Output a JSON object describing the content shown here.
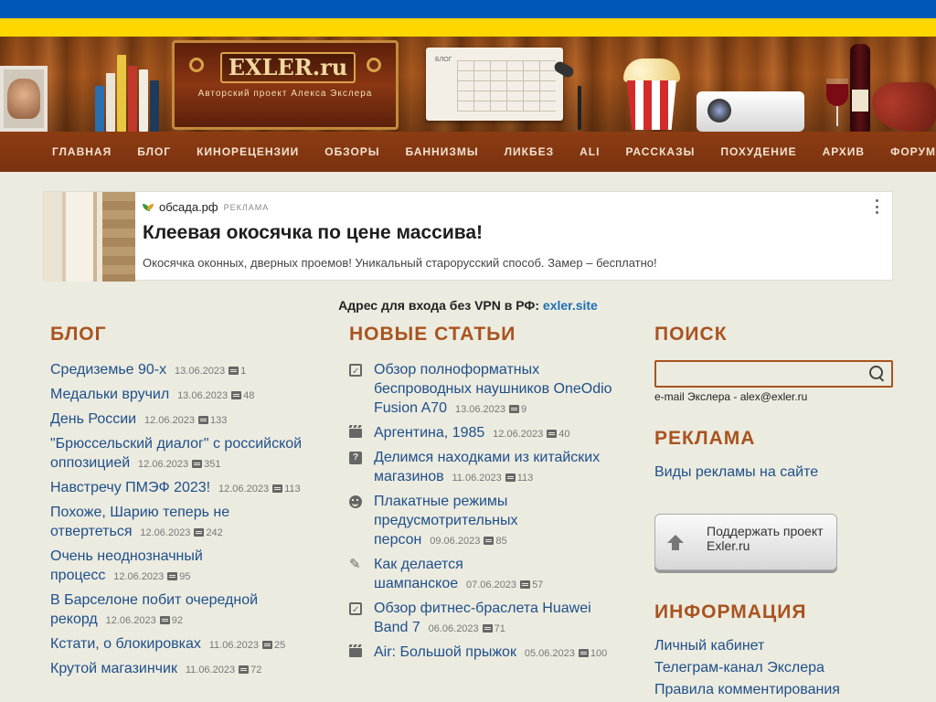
{
  "header": {
    "logo_title": "EXLER.ru",
    "logo_subtitle": "Авторский проект Алекса Экслера",
    "calendar_label": "БЛОГ"
  },
  "nav": {
    "items": [
      "Главная",
      "Блог",
      "Кинорецензии",
      "Обзоры",
      "Баннизмы",
      "Ликбез",
      "ALI",
      "Рассказы",
      "Похудение",
      "Архив",
      "Форум"
    ]
  },
  "ad": {
    "domain": "обсада.рф",
    "tag": "РЕКЛАМА",
    "title": "Клеевая окосячка по цене массива!",
    "text": "Окосячка оконных, дверных проемов! Уникальный старорусский способ. Замер – бесплатно!"
  },
  "vpn": {
    "prefix": "Адрес для входа без VPN в РФ: ",
    "link": "exler.site"
  },
  "blog": {
    "title": "Блог",
    "items": [
      {
        "title": "Средиземье 90-х",
        "date": "13.06.2023",
        "comments": "1"
      },
      {
        "title": "Медальки вручил",
        "date": "13.06.2023",
        "comments": "48"
      },
      {
        "title": "День России",
        "date": "12.06.2023",
        "comments": "133"
      },
      {
        "title": "\"Брюссельский диалог\" с российской оппозицией",
        "date": "12.06.2023",
        "comments": "351"
      },
      {
        "title": "Навстречу ПМЭФ 2023!",
        "date": "12.06.2023",
        "comments": "113"
      },
      {
        "title": "Похоже, Шарию теперь не отвертеться",
        "date": "12.06.2023",
        "comments": "242"
      },
      {
        "title": "Очень неоднозначный процесс",
        "date": "12.06.2023",
        "comments": "95"
      },
      {
        "title": "В Барселоне побит очередной рекорд",
        "date": "12.06.2023",
        "comments": "92"
      },
      {
        "title": "Кстати, о блокировках",
        "date": "11.06.2023",
        "comments": "25"
      },
      {
        "title": "Крутой магазинчик",
        "date": "11.06.2023",
        "comments": "72"
      }
    ]
  },
  "articles": {
    "title": "Новые статьи",
    "items": [
      {
        "icon": "review",
        "title": "Обзор полноформатных беспроводных наушников OneOdio Fusion A70",
        "date": "13.06.2023",
        "comments": "9"
      },
      {
        "icon": "movie",
        "title": "Аргентина, 1985",
        "date": "12.06.2023",
        "comments": "40"
      },
      {
        "icon": "question",
        "title": "Делимся находками из китайских магазинов",
        "date": "11.06.2023",
        "comments": "113"
      },
      {
        "icon": "smile",
        "title": "Плакатные режимы предусмотрительных персон",
        "date": "09.06.2023",
        "comments": "85"
      },
      {
        "icon": "pencil",
        "title": "Как делается шампанское",
        "date": "07.06.2023",
        "comments": "57"
      },
      {
        "icon": "review",
        "title": "Обзор фитнес-браслета Huawei Band 7",
        "date": "06.06.2023",
        "comments": "71"
      },
      {
        "icon": "movie",
        "title": "Air: Большой прыжок",
        "date": "05.06.2023",
        "comments": "100"
      }
    ]
  },
  "search": {
    "title": "Поиск",
    "email": "e-mail Экслера - alex@exler.ru"
  },
  "ads_section": {
    "title": "Реклама",
    "link": "Виды рекламы на сайте"
  },
  "support": {
    "label": "Поддержать проект Exler.ru"
  },
  "info": {
    "title": "Информация",
    "links": [
      "Личный кабинет",
      "Телеграм-канал Экслера",
      "Правила комментирования"
    ]
  },
  "colors": {
    "accent": "#a9531f",
    "link": "#1e4f8a",
    "nav_bg": "#8d3c12",
    "flag_blue": "#0057b8",
    "flag_yellow": "#ffd700"
  }
}
